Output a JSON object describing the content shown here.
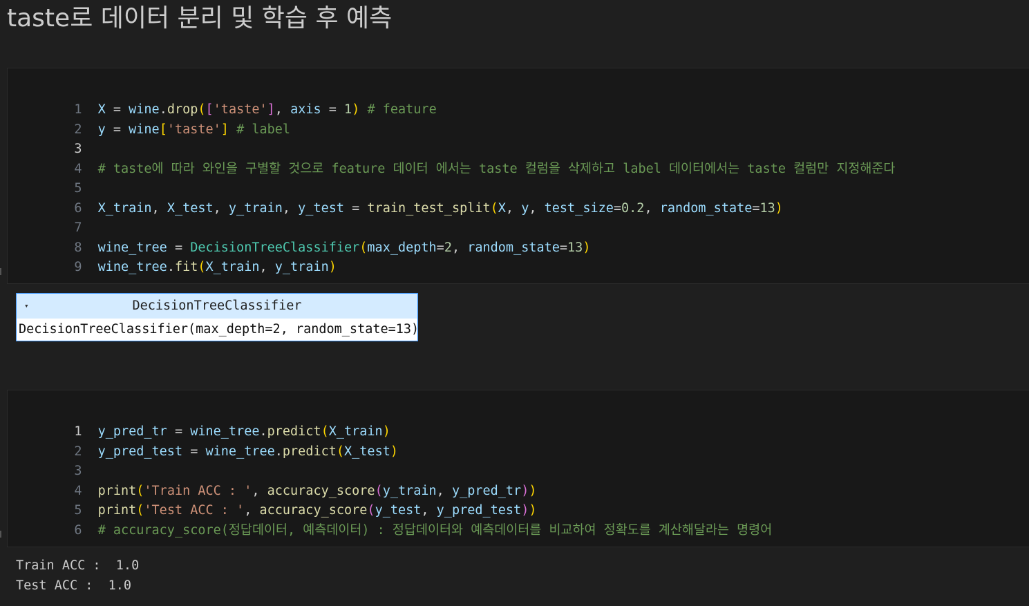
{
  "heading": "taste로 데이터 분리 및 학습 후 예측",
  "cell1": {
    "line_numbers": [
      "1",
      "2",
      "3",
      "4",
      "5",
      "6",
      "7",
      "8",
      "9"
    ],
    "line1": {
      "a": "X",
      "b": " = ",
      "c": "wine",
      "d": ".",
      "e": "drop",
      "f": "(",
      "g": "[",
      "h": "'taste'",
      "i": "]",
      "j": ", ",
      "k": "axis",
      "l": " = ",
      "m": "1",
      "n": ")",
      "o": " # feature"
    },
    "line2": {
      "a": "y",
      "b": " = ",
      "c": "wine",
      "d": "[",
      "e": "'taste'",
      "f": "]",
      "g": " # label"
    },
    "line4": "# taste에 따라 와인을 구별할 것으로 feature 데이터 에서는 taste 컬럼을 삭제하고 label 데이터에서는 taste 컬럼만 지정해준다",
    "line6": {
      "a": "X_train",
      "b": ", ",
      "c": "X_test",
      "d": ", ",
      "e": "y_train",
      "f": ", ",
      "g": "y_test",
      "h": " = ",
      "i": "train_test_split",
      "j": "(",
      "k": "X",
      "l": ", ",
      "m": "y",
      "n": ", ",
      "o": "test_size",
      "p": "=",
      "q": "0.2",
      "r": ", ",
      "s": "random_state",
      "t": "=",
      "u": "13",
      "w": ")"
    },
    "line8": {
      "a": "wine_tree",
      "b": " = ",
      "c": "DecisionTreeClassifier",
      "d": "(",
      "e": "max_depth",
      "f": "=",
      "g": "2",
      "h": ", ",
      "i": "random_state",
      "j": "=",
      "k": "13",
      "l": ")"
    },
    "line9": {
      "a": "wine_tree",
      "b": ".",
      "c": "fit",
      "d": "(",
      "e": "X_train",
      "f": ", ",
      "g": "y_train",
      "h": ")"
    }
  },
  "widget": {
    "arrow": "▾",
    "title": "DecisionTreeClassifier",
    "body": "DecisionTreeClassifier(max_depth=2, random_state=13)"
  },
  "cell2": {
    "line_numbers": [
      "1",
      "2",
      "3",
      "4",
      "5",
      "6"
    ],
    "line1": {
      "a": "y_pred_tr",
      "b": " = ",
      "c": "wine_tree",
      "d": ".",
      "e": "predict",
      "f": "(",
      "g": "X_train",
      "h": ")"
    },
    "line2": {
      "a": "y_pred_test",
      "b": " = ",
      "c": "wine_tree",
      "d": ".",
      "e": "predict",
      "f": "(",
      "g": "X_test",
      "h": ")"
    },
    "line4": {
      "a": "print",
      "b": "(",
      "c": "'Train ACC : '",
      "d": ", ",
      "e": "accuracy_score",
      "f": "(",
      "g": "y_train",
      "h": ", ",
      "i": "y_pred_tr",
      "j": ")",
      "k": ")"
    },
    "line5": {
      "a": "print",
      "b": "(",
      "c": "'Test ACC : '",
      "d": ", ",
      "e": "accuracy_score",
      "f": "(",
      "g": "y_test",
      "h": ", ",
      "i": "y_pred_test",
      "j": ")",
      "k": ")"
    },
    "line6": "# accuracy_score(정답데이터, 예측데이터) : 정답데이터와 예측데이터를 비교하여 정확도를 계산해달라는 명령어"
  },
  "output": {
    "line1": "Train ACC :  1.0",
    "line2": "Test ACC :  1.0"
  }
}
